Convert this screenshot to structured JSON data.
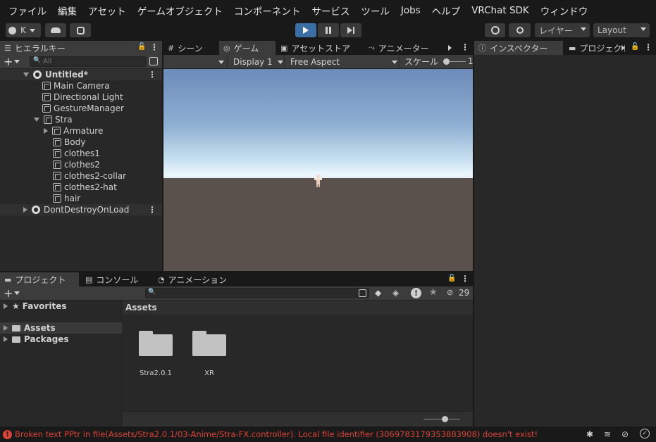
{
  "menubar": {
    "items": [
      "ファイル",
      "編集",
      "アセット",
      "ゲームオブジェクト",
      "コンポーネント",
      "サービス",
      "ツール",
      "Jobs",
      "ヘルプ",
      "VRChat SDK",
      "ウィンドウ"
    ]
  },
  "toolbar": {
    "account_label": "K",
    "history_icon": "history-icon",
    "layers_label": "レイヤー",
    "layout_label": "Layout"
  },
  "hierarchy": {
    "tab_label": "ヒエラルキー",
    "search_placeholder": "All",
    "rows": [
      {
        "label": "Untitled*",
        "depth": 0
      },
      {
        "label": "Main Camera",
        "depth": 1
      },
      {
        "label": "Directional Light",
        "depth": 1
      },
      {
        "label": "GestureManager",
        "depth": 1
      },
      {
        "label": "Stra",
        "depth": 1
      },
      {
        "label": "Armature",
        "depth": 2
      },
      {
        "label": "Body",
        "depth": 2
      },
      {
        "label": "clothes1",
        "depth": 2
      },
      {
        "label": "clothes2",
        "depth": 2
      },
      {
        "label": "clothes2-collar",
        "depth": 2
      },
      {
        "label": "clothes2-hat",
        "depth": 2
      },
      {
        "label": "hair",
        "depth": 2
      },
      {
        "label": "DontDestroyOnLoad",
        "depth": 0
      }
    ]
  },
  "center_tabs": {
    "scene": "シーン",
    "game": "ゲーム",
    "asset_store": "アセットストア",
    "animator": "アニメーター"
  },
  "game_view": {
    "display": "Display 1",
    "aspect": "Free Aspect",
    "scale_label": "スケール",
    "scale_value": "1"
  },
  "right_tabs": {
    "inspector": "インスペクター",
    "project": "プロジェクト"
  },
  "bottom_tabs": {
    "project": "プロジェクト",
    "console": "コンソール",
    "animation": "アニメーション",
    "hidden_count": "29"
  },
  "project": {
    "favorites": "Favorites",
    "assets": "Assets",
    "packages": "Packages",
    "breadcrumb": "Assets",
    "folders": [
      "Stra2.0.1",
      "XR"
    ]
  },
  "status": {
    "message": "Broken text PPtr in file(Assets/Stra2.0.1/03-Anime/Stra-FX.controller). Local file identifier (3069783179353883908) doesn't exist!",
    "error_color": "#d8443a"
  }
}
